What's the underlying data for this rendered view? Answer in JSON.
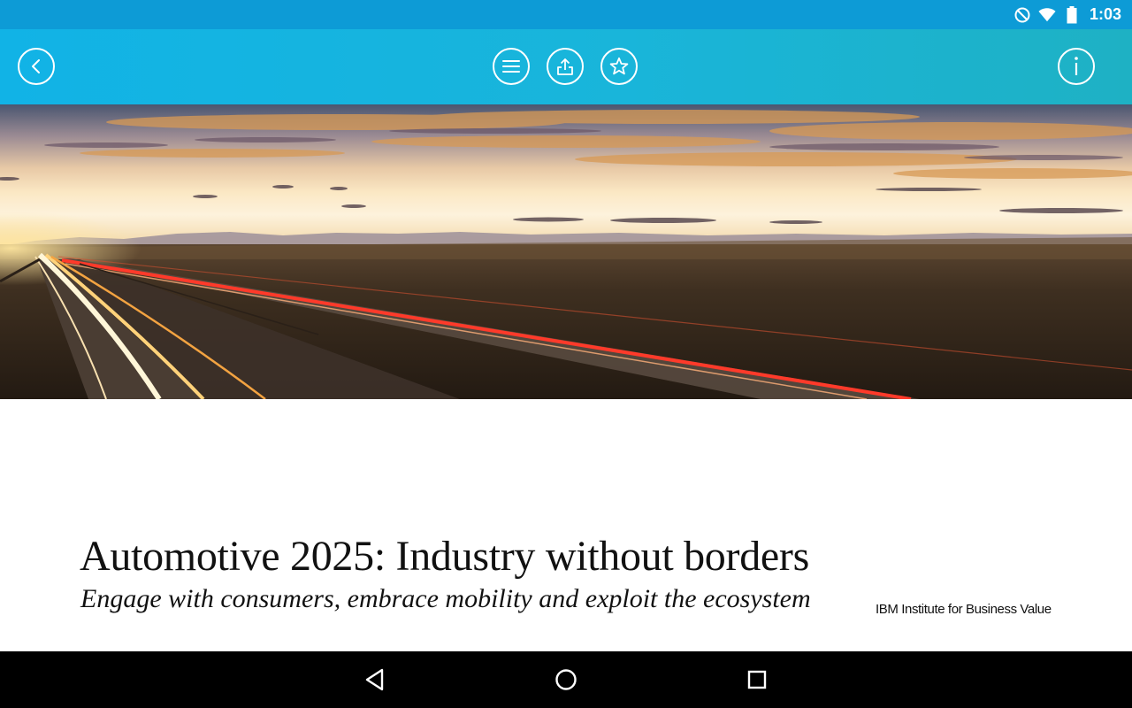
{
  "status_bar": {
    "time": "1:03",
    "icons": [
      "do-not-disturb-icon",
      "wifi-icon",
      "battery-icon"
    ]
  },
  "toolbar": {
    "buttons": [
      {
        "icon": "chevron-left-icon",
        "action": "back"
      },
      {
        "icon": "menu-icon",
        "action": "table-of-contents"
      },
      {
        "icon": "share-icon",
        "action": "share"
      },
      {
        "icon": "star-icon",
        "action": "favorite"
      },
      {
        "icon": "info-icon",
        "action": "info"
      }
    ],
    "accent_color": "#11b3e6"
  },
  "hero": {
    "image": "highway-at-sunset-photo"
  },
  "document": {
    "title": "Automotive 2025: Industry without borders",
    "subtitle": "Engage with consumers, embrace mobility and exploit the ecosystem",
    "publisher": "IBM Institute for Business Value"
  },
  "nav_bar": {
    "buttons": [
      "back-icon",
      "home-icon",
      "recents-icon"
    ]
  }
}
